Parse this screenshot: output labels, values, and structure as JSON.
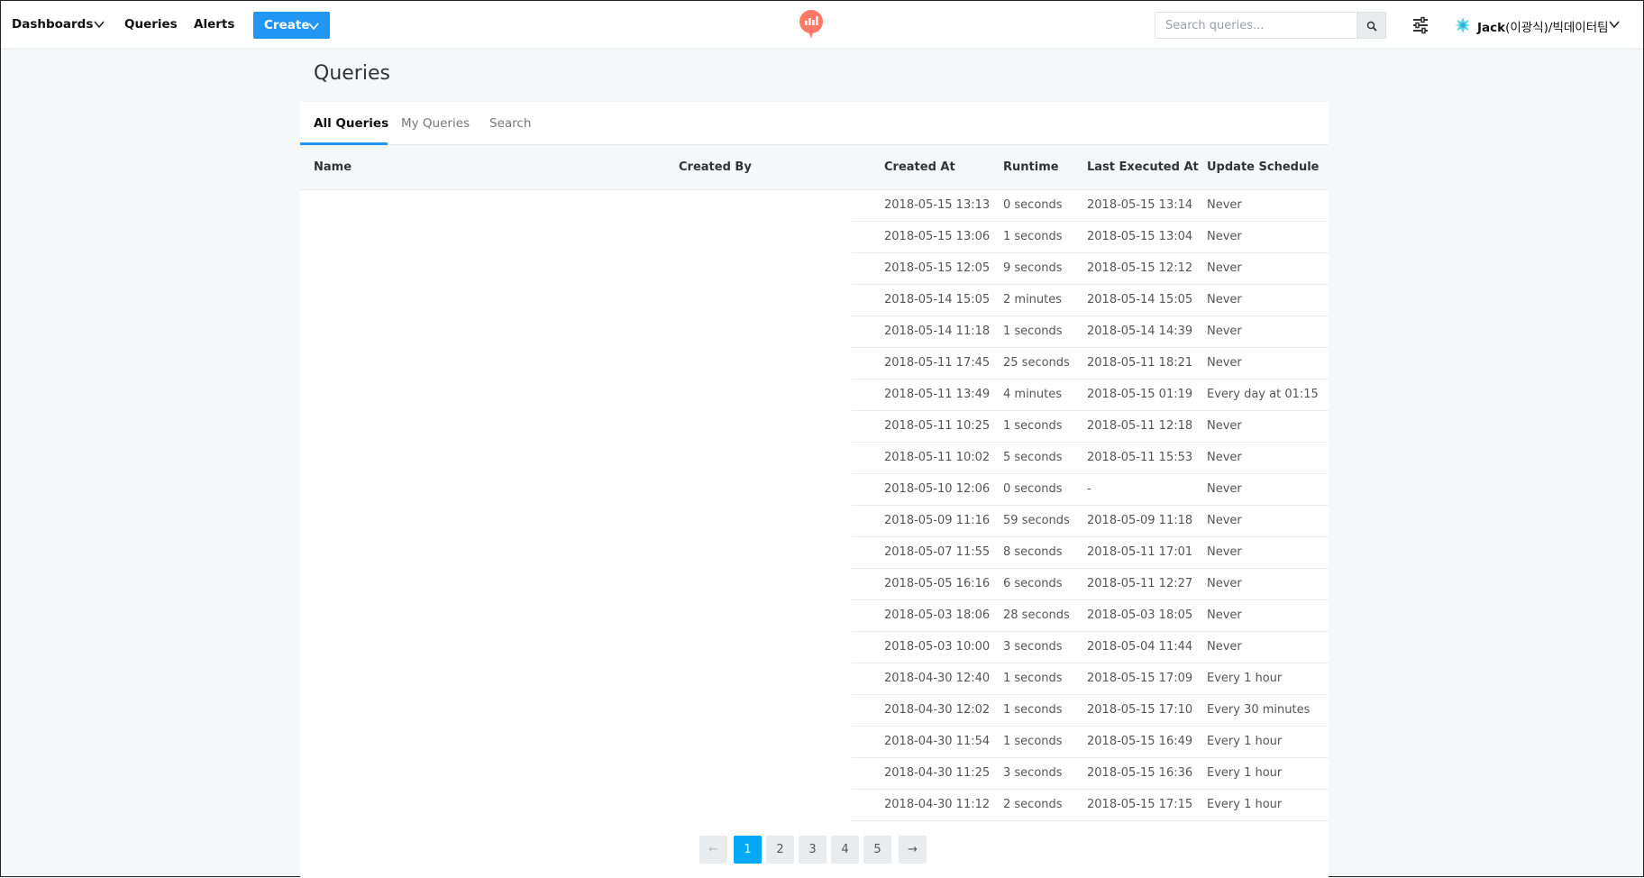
{
  "nav": {
    "dashboards": "Dashboards",
    "queries": "Queries",
    "alerts": "Alerts",
    "create": "Create"
  },
  "search": {
    "placeholder": "Search queries..."
  },
  "user": {
    "name_bold": "Jack",
    "name_rest": "(이광식)/빅데이터팀"
  },
  "page": {
    "title": "Queries"
  },
  "tabs": [
    {
      "label": "All Queries",
      "active": true
    },
    {
      "label": "My Queries",
      "active": false
    },
    {
      "label": "Search",
      "active": false
    }
  ],
  "table": {
    "columns": [
      "Name",
      "Created By",
      "Created At",
      "Runtime",
      "Last Executed At",
      "Update Schedule"
    ],
    "rows": [
      [
        "",
        "",
        "2018-05-15 13:13",
        "0 seconds",
        "2018-05-15 13:14",
        "Never"
      ],
      [
        "",
        "",
        "2018-05-15 13:06",
        "1 seconds",
        "2018-05-15 13:04",
        "Never"
      ],
      [
        "",
        "",
        "2018-05-15 12:05",
        "9 seconds",
        "2018-05-15 12:12",
        "Never"
      ],
      [
        "",
        "",
        "2018-05-14 15:05",
        "2 minutes",
        "2018-05-14 15:05",
        "Never"
      ],
      [
        "",
        "",
        "2018-05-14 11:18",
        "1 seconds",
        "2018-05-14 14:39",
        "Never"
      ],
      [
        "",
        "",
        "2018-05-11 17:45",
        "25 seconds",
        "2018-05-11 18:21",
        "Never"
      ],
      [
        "",
        "",
        "2018-05-11 13:49",
        "4 minutes",
        "2018-05-15 01:19",
        "Every day at 01:15"
      ],
      [
        "",
        "",
        "2018-05-11 10:25",
        "1 seconds",
        "2018-05-11 12:18",
        "Never"
      ],
      [
        "",
        "",
        "2018-05-11 10:02",
        "5 seconds",
        "2018-05-11 15:53",
        "Never"
      ],
      [
        "",
        "",
        "2018-05-10 12:06",
        "0 seconds",
        "-",
        "Never"
      ],
      [
        "",
        "",
        "2018-05-09 11:16",
        "59 seconds",
        "2018-05-09 11:18",
        "Never"
      ],
      [
        "",
        "",
        "2018-05-07 11:55",
        "8 seconds",
        "2018-05-11 17:01",
        "Never"
      ],
      [
        "",
        "",
        "2018-05-05 16:16",
        "6 seconds",
        "2018-05-11 12:27",
        "Never"
      ],
      [
        "",
        "",
        "2018-05-03 18:06",
        "28 seconds",
        "2018-05-03 18:05",
        "Never"
      ],
      [
        "",
        "",
        "2018-05-03 10:00",
        "3 seconds",
        "2018-05-04 11:44",
        "Never"
      ],
      [
        "",
        "",
        "2018-04-30 12:40",
        "1 seconds",
        "2018-05-15 17:09",
        "Every 1 hour"
      ],
      [
        "",
        "",
        "2018-04-30 12:02",
        "1 seconds",
        "2018-05-15 17:10",
        "Every 30 minutes"
      ],
      [
        "",
        "",
        "2018-04-30 11:54",
        "1 seconds",
        "2018-05-15 16:49",
        "Every 1 hour"
      ],
      [
        "",
        "",
        "2018-04-30 11:25",
        "3 seconds",
        "2018-05-15 16:36",
        "Every 1 hour"
      ],
      [
        "",
        "",
        "2018-04-30 11:12",
        "2 seconds",
        "2018-05-15 17:15",
        "Every 1 hour"
      ]
    ]
  },
  "pagination": {
    "prev": "←",
    "pages": [
      "1",
      "2",
      "3",
      "4",
      "5"
    ],
    "active_page": "1",
    "next": "→"
  },
  "colors": {
    "accent": "#2196F3",
    "active_page": "#03A9F4",
    "logo": "#ff7964"
  },
  "icons": {
    "dashboards_chevron": "chevron-down-icon",
    "create_chevron": "chevron-down-icon",
    "logo": "redash-logo-icon",
    "search": "search-icon",
    "settings": "sliders-icon",
    "avatar": "user-avatar-icon",
    "user_chevron": "chevron-down-icon"
  }
}
